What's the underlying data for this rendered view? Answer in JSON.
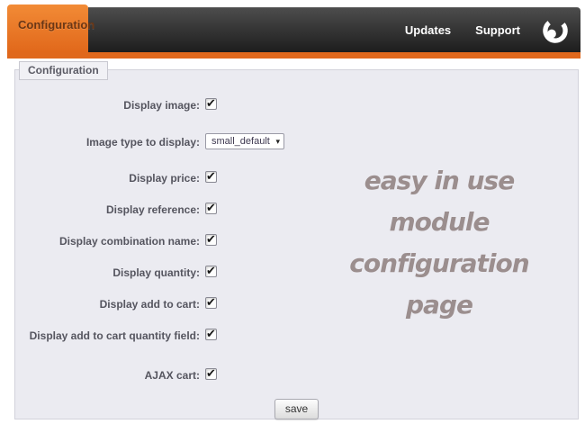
{
  "header": {
    "tab_label": "Configuration",
    "nav": [
      {
        "label": "Updates"
      },
      {
        "label": "Support"
      }
    ]
  },
  "panel": {
    "legend": "Configuration",
    "rows": [
      {
        "label": "Display image:",
        "type": "checkbox",
        "checked": true
      },
      {
        "label": "Image type to display:",
        "type": "select",
        "value": "small_default"
      },
      {
        "label": "Display price:",
        "type": "checkbox",
        "checked": true
      },
      {
        "label": "Display reference:",
        "type": "checkbox",
        "checked": true
      },
      {
        "label": "Display combination name:",
        "type": "checkbox",
        "checked": true
      },
      {
        "label": "Display quantity:",
        "type": "checkbox",
        "checked": true
      },
      {
        "label": "Display add to cart:",
        "type": "checkbox",
        "checked": true
      },
      {
        "label": "Display add to cart quantity field:",
        "type": "checkbox",
        "checked": true
      },
      {
        "label": "AJAX cart:",
        "type": "checkbox",
        "checked": true
      }
    ],
    "save_label": "save"
  },
  "watermark": {
    "lines": [
      "easy in use",
      "module",
      "configuration",
      "page"
    ],
    "color": "#9b8e8e"
  },
  "icons": {
    "chevron_down": "▾",
    "check": "✔"
  },
  "colors": {
    "accent_orange": "#e8732a",
    "accent_orange_strip": "#e0681c",
    "header_dark": "#2e2e2e",
    "panel_background": "#ebebf1"
  }
}
